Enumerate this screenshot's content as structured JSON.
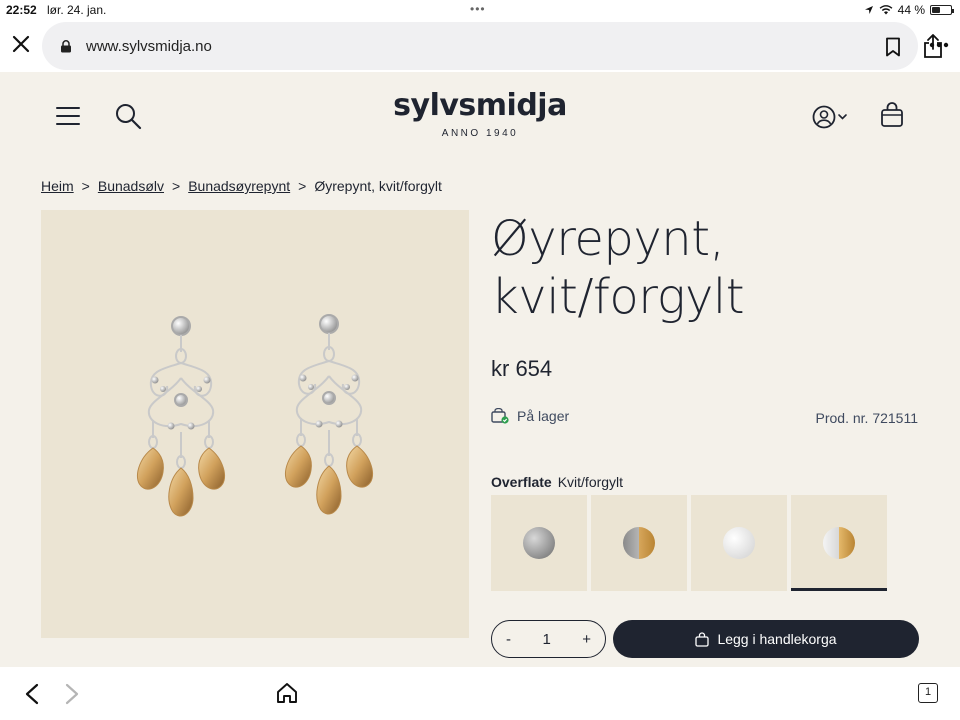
{
  "status_bar": {
    "time": "22:52",
    "date": "lør. 24. jan.",
    "battery": "44 %",
    "battery_level": 0.44
  },
  "browser": {
    "url": "www.sylvsmidja.no",
    "tab_count": "1"
  },
  "header": {
    "logo": "sylvsmidja",
    "logo_sub": "ANNO 1940"
  },
  "breadcrumb": {
    "items": [
      "Heim",
      "Bunadsølv",
      "Bunadsøyrepynt"
    ],
    "current": "Øyrepynt, kvit/forgylt",
    "separator": ">"
  },
  "product": {
    "title_line1": "Øyrepynt,",
    "title_line2": "kvit/forgylt",
    "price": "kr 654",
    "stock": "På lager",
    "prod_nr": "Prod. nr. 721511",
    "finish_label": "Overflate",
    "finish_value": "Kvit/forgylt",
    "quantity": "1",
    "minus": "-",
    "plus": "+",
    "add_to_cart": "Legg i handlekorga"
  },
  "colors": {
    "brand_dark": "#1f2430",
    "page_bg": "#f4f1ea",
    "image_bg": "#ebe4d3",
    "stock_green": "#2e9e4f"
  }
}
